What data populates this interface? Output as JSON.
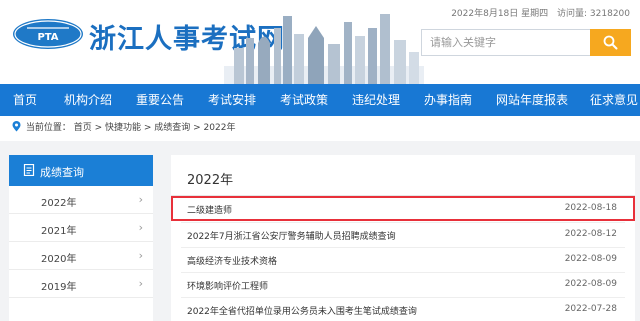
{
  "header": {
    "site_title": "浙江人事考试网",
    "logo_text": "PTA",
    "date_text": "2022年8月18日 星期四",
    "visits_text": "访问量: 3218200",
    "search_placeholder": "请输入关键字",
    "brand_color": "#1b6fc0",
    "search_button_color": "#f6a81f"
  },
  "nav": {
    "bg_color": "#1878d4",
    "items": [
      "首页",
      "机构介绍",
      "重要公告",
      "考试安排",
      "考试政策",
      "违纪处理",
      "办事指南",
      "网站年度报表",
      "征求意见"
    ]
  },
  "breadcrumb": {
    "prefix": "当前位置：",
    "path": "首页 > 快捷功能 > 成绩查询 > 2022年"
  },
  "sidebar": {
    "title": "成绩查询",
    "items": [
      {
        "label": "2022年"
      },
      {
        "label": "2021年"
      },
      {
        "label": "2020年"
      },
      {
        "label": "2019年"
      }
    ]
  },
  "main": {
    "title": "2022年",
    "rows": [
      {
        "title": "二级建造师",
        "date": "2022-08-18",
        "highlighted": true
      },
      {
        "title": "2022年7月浙江省公安厅警务辅助人员招聘成绩查询",
        "date": "2022-08-12"
      },
      {
        "title": "高级经济专业技术资格",
        "date": "2022-08-09"
      },
      {
        "title": "环境影响评价工程师",
        "date": "2022-08-09"
      },
      {
        "title": "2022年全省代招单位录用公务员未入围考生笔试成绩查询",
        "date": "2022-07-28"
      }
    ]
  }
}
